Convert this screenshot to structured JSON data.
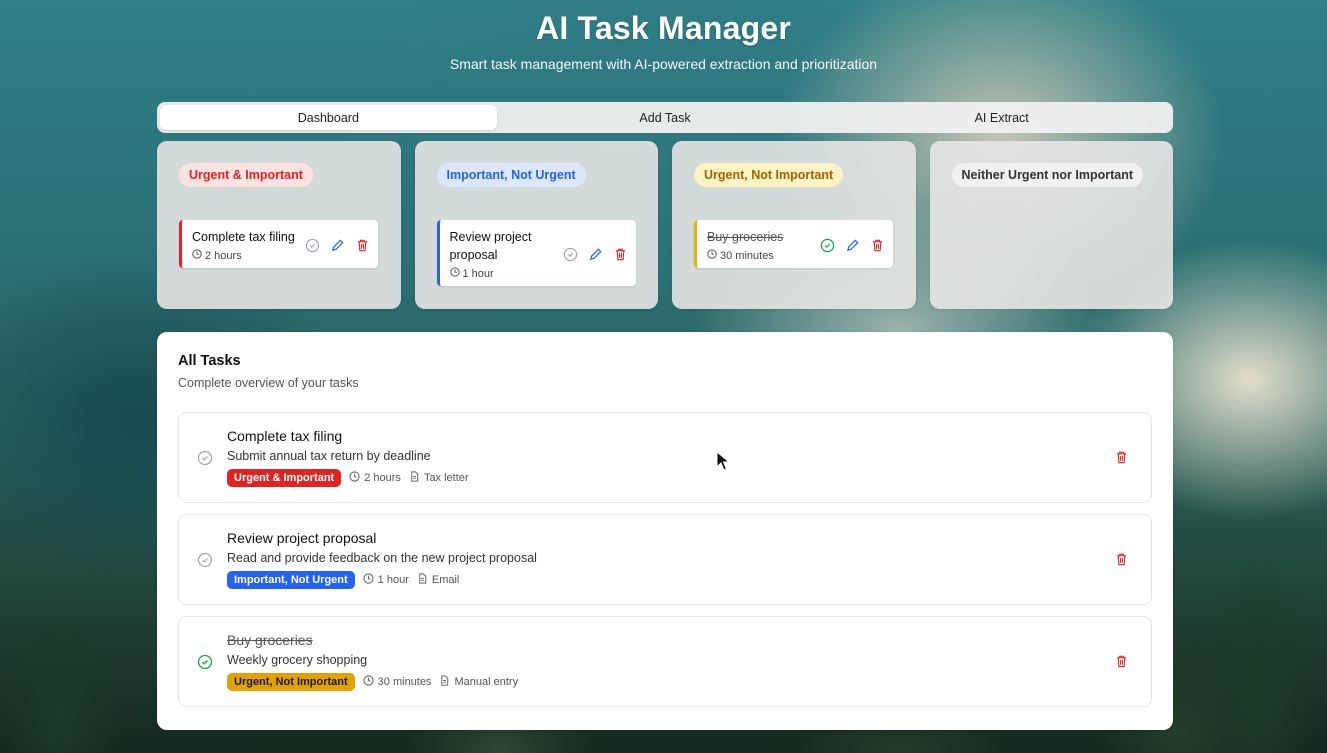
{
  "header": {
    "title": "AI Task Manager",
    "subtitle": "Smart task management with AI-powered extraction and prioritization"
  },
  "tabs": [
    {
      "label": "Dashboard",
      "active": true
    },
    {
      "label": "Add Task",
      "active": false
    },
    {
      "label": "AI Extract",
      "active": false
    }
  ],
  "quadrants": [
    {
      "label": "Urgent & Important",
      "color": "#dc2626",
      "task": {
        "title": "Complete tax filing",
        "time": "2 hours",
        "completed": false
      }
    },
    {
      "label": "Important, Not Urgent",
      "color": "#2563eb",
      "task": {
        "title": "Review project proposal",
        "time": "1 hour",
        "completed": false
      }
    },
    {
      "label": "Urgent, Not Important",
      "color": "#eab308",
      "task": {
        "title": "Buy groceries",
        "time": "30 minutes",
        "completed": true
      }
    },
    {
      "label": "Neither Urgent nor Important",
      "color": "#9ca3af",
      "task": null
    }
  ],
  "all_tasks": {
    "title": "All Tasks",
    "subtitle": "Complete overview of your tasks",
    "items": [
      {
        "title": "Complete tax filing",
        "description": "Submit annual tax return by deadline",
        "tag": "Urgent & Important",
        "time": "2 hours",
        "source": "Tax letter",
        "completed": false
      },
      {
        "title": "Review project proposal",
        "description": "Read and provide feedback on the new project proposal",
        "tag": "Important, Not Urgent",
        "time": "1 hour",
        "source": "Email",
        "completed": false
      },
      {
        "title": "Buy groceries",
        "description": "Weekly grocery shopping",
        "tag": "Urgent, Not Important",
        "time": "30 minutes",
        "source": "Manual entry",
        "completed": true
      }
    ]
  },
  "colors": {
    "red": "#dc2626",
    "blue": "#2563eb",
    "yellow": "#eab308",
    "green": "#16a34a"
  }
}
